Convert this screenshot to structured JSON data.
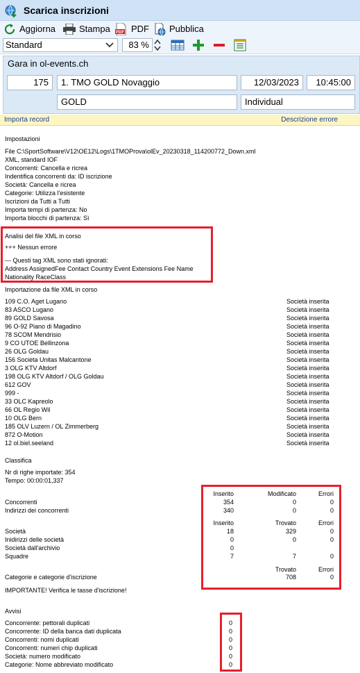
{
  "window": {
    "title": "Scarica inscrizioni"
  },
  "toolbar": {
    "refresh": "Aggiorna",
    "print": "Stampa",
    "pdf": "PDF",
    "publish": "Pubblica",
    "pdf_icon_text": "PDF"
  },
  "view": {
    "selected": "Standard",
    "zoom": "83 %"
  },
  "race": {
    "group_title": "Gara in ol-events.ch",
    "number": "175",
    "name": "1. TMO GOLD Novaggio",
    "date": "12/03/2023",
    "time": "10:45:00",
    "club": "GOLD",
    "type": "Individual"
  },
  "log_header": {
    "left": "Importa record",
    "right": "Descrizione errore"
  },
  "settings": {
    "title": "Impostazioni",
    "lines": [
      "File C:\\SportSoftware\\V12\\OE12\\Logs\\1TMOProva\\olEv_20230318_114200772_Down.xml",
      "XML, standard IOF",
      "Concorrenti: Cancella e ricrea",
      "Indentifica concorrenti da: ID iscrizione",
      "Società: Cancella e ricrea",
      "Categorie: Utilizza l'esistente",
      "Iscrizioni  da Tutti a Tutti",
      "Importa tempi di partenza: No",
      "Importa blocchi di partenza: Sì"
    ]
  },
  "analysis": {
    "title": "Analisi del file XML in corso",
    "no_errors": "+++ Nessun errore",
    "ignored_title": "--- Questi tag XML sono stati ignorati:",
    "ignored_line1": "Address AssignedFee Contact Country Event Extensions Fee Name",
    "ignored_line2": "Nationality RaceClass"
  },
  "import": {
    "title": "Importazione da file XML in corso",
    "rows": [
      {
        "club": "109 C.O. Aget Lugano",
        "status": "Società inserita"
      },
      {
        "club": "83 ASCO Lugano",
        "status": "Società inserita"
      },
      {
        "club": "89 GOLD Savosa",
        "status": "Società inserita"
      },
      {
        "club": "96 O-92 Piano di Magadino",
        "status": "Società inserita"
      },
      {
        "club": "78 SCOM Mendrisio",
        "status": "Società inserita"
      },
      {
        "club": "9 CO UTOE Bellinzona",
        "status": "Società inserita"
      },
      {
        "club": "26 OLG Goldau",
        "status": "Società inserita"
      },
      {
        "club": "156 Societa Unitas Malcantone",
        "status": "Società inserita"
      },
      {
        "club": "3 OLG KTV Altdorf",
        "status": "Società inserita"
      },
      {
        "club": "198 OLG KTV Altdorf / OLG Goldau",
        "status": "Società inserita"
      },
      {
        "club": "612 GOV",
        "status": "Società inserita"
      },
      {
        "club": "999 -",
        "status": "Società inserita"
      },
      {
        "club": "33 OLC Kapreolo",
        "status": "Società inserita"
      },
      {
        "club": "66 OL Regio Wil",
        "status": "Società inserita"
      },
      {
        "club": "10 OLG Bern",
        "status": "Società inserita"
      },
      {
        "club": "185 OLV Luzern / OL Zimmerberg",
        "status": "Società inserita"
      },
      {
        "club": "872 O-Motion",
        "status": "Società inserita"
      },
      {
        "club": "12 ol.biel.seeland",
        "status": "Società inserita"
      }
    ]
  },
  "summary": {
    "title": "Classifica",
    "rows_imported": "Nr di righe importate: 354",
    "time": "Tempo: 00:00:01,337",
    "block1": {
      "headers": [
        "Inserito",
        "Modificato",
        "Errori"
      ],
      "rows": [
        {
          "label": "Concorrenti",
          "values": [
            "354",
            "0",
            "0"
          ]
        },
        {
          "label": "Indirizzi dei concorrenti",
          "values": [
            "340",
            "0",
            "0"
          ]
        }
      ]
    },
    "block2": {
      "headers": [
        "Inserito",
        "Trovato",
        "Errori"
      ],
      "rows": [
        {
          "label": "Società",
          "values": [
            "18",
            "329",
            "0"
          ]
        },
        {
          "label": "Inidirizzi delle società",
          "values": [
            "0",
            "0",
            "0"
          ]
        },
        {
          "label": "Società dall'archivio",
          "values": [
            "0",
            "",
            ""
          ]
        },
        {
          "label": "Squadre",
          "values": [
            "7",
            "7",
            "0"
          ]
        }
      ]
    },
    "block3": {
      "headers": [
        "Trovato",
        "Errori"
      ],
      "rows": [
        {
          "label": "Categorie e categorie d'iscrizione",
          "values": [
            "708",
            "0"
          ]
        }
      ]
    },
    "important": "IMPORTANTE! Verifica le tasse d'iscrizione!"
  },
  "warnings": {
    "title": "Avvisi",
    "rows": [
      {
        "label": "Concorrente: pettorali duplicati",
        "value": "0"
      },
      {
        "label": "Concorrente: ID della banca dati duplicata",
        "value": "0"
      },
      {
        "label": "Concorrenti: nomi duplicati",
        "value": "0"
      },
      {
        "label": "Concorrenti: numeri chip duplicati",
        "value": "0"
      },
      {
        "label": "Società: numero modificato",
        "value": "0"
      },
      {
        "label": "Categorie: Nome abbreviato modificato",
        "value": "0"
      }
    ]
  },
  "colors": {
    "highlight_box": "#e5202c",
    "title_bar": "#cfe2f6",
    "log_header_bg": "#fdf6c3"
  }
}
